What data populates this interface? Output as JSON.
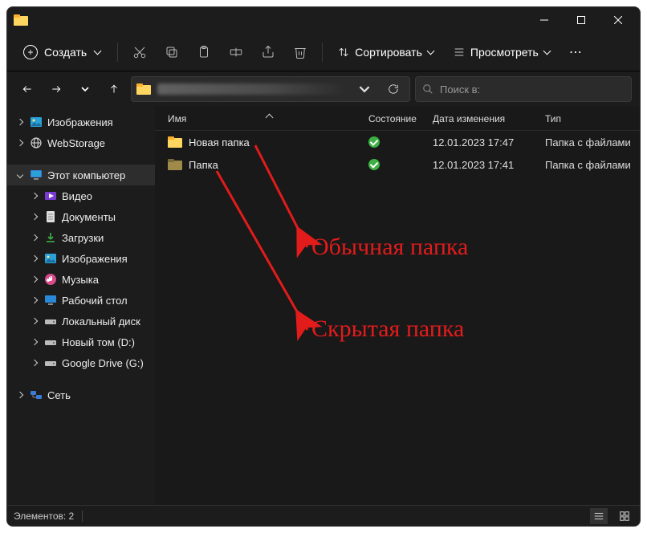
{
  "titlebar": {},
  "toolbar": {
    "new_label": "Создать",
    "sort_label": "Сортировать",
    "view_label": "Просмотреть"
  },
  "search": {
    "placeholder": "Поиск в:"
  },
  "sidebar": {
    "items": [
      {
        "label": "Изображения"
      },
      {
        "label": "WebStorage"
      },
      {
        "label": "Этот компьютер"
      },
      {
        "label": "Видео"
      },
      {
        "label": "Документы"
      },
      {
        "label": "Загрузки"
      },
      {
        "label": "Изображения"
      },
      {
        "label": "Музыка"
      },
      {
        "label": "Рабочий стол"
      },
      {
        "label": "Локальный диск"
      },
      {
        "label": "Новый том (D:)"
      },
      {
        "label": "Google Drive (G:)"
      },
      {
        "label": "Сеть"
      }
    ]
  },
  "columns": {
    "name": "Имя",
    "state": "Состояние",
    "date": "Дата изменения",
    "type": "Тип"
  },
  "rows": [
    {
      "name": "Новая папка",
      "date": "12.01.2023 17:47",
      "type": "Папка с файлами",
      "hidden": false
    },
    {
      "name": "Папка",
      "date": "12.01.2023 17:41",
      "type": "Папка с файлами",
      "hidden": true
    }
  ],
  "statusbar": {
    "count_label": "Элементов: 2"
  },
  "annotations": {
    "normal": "Обычная папка",
    "hidden": "Скрытая папка"
  }
}
